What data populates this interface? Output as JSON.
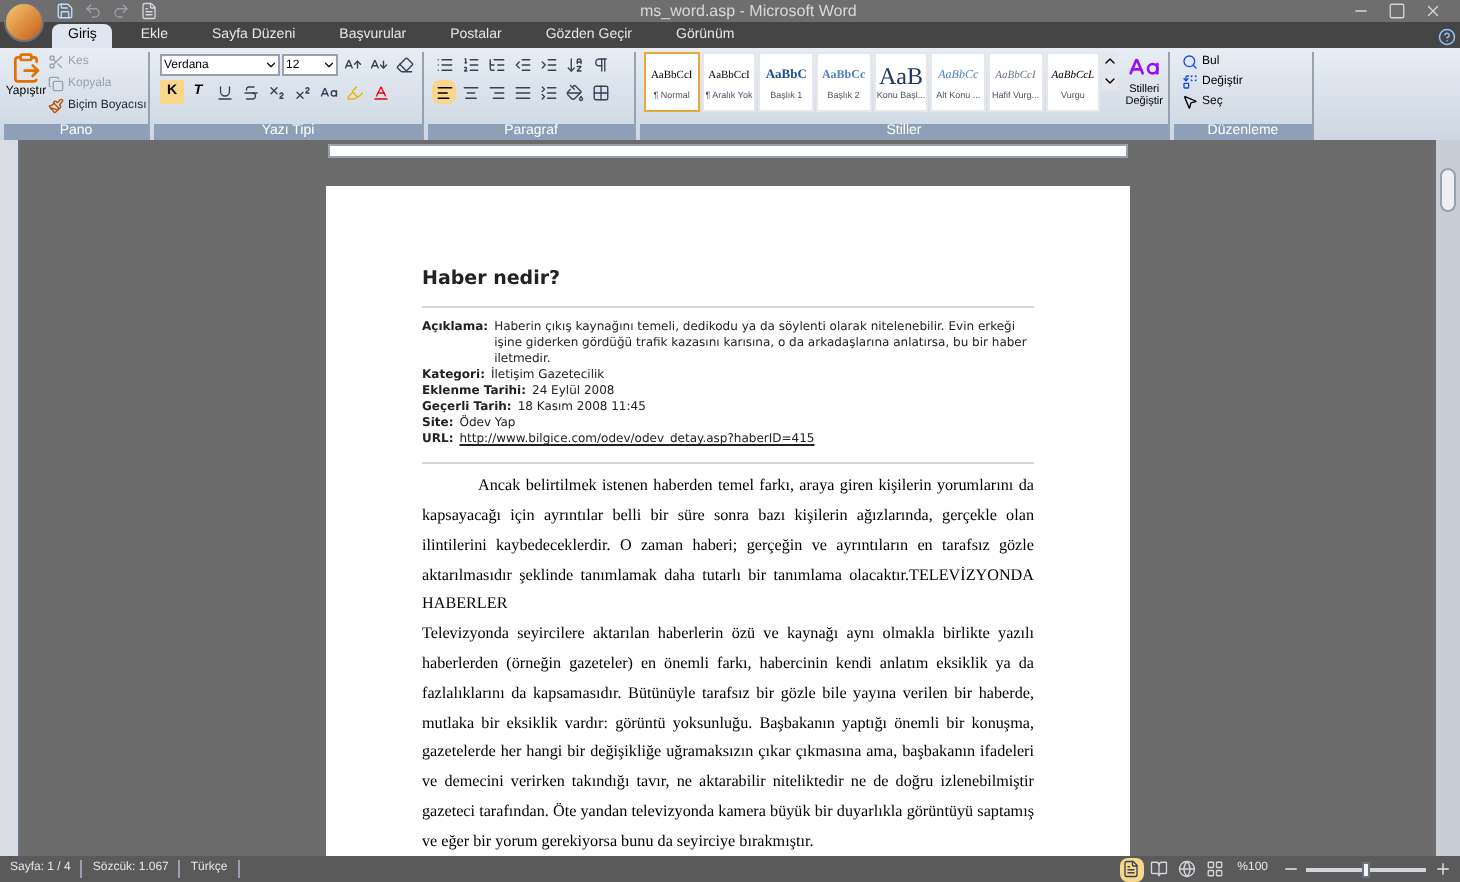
{
  "window": {
    "title": "ms_word.asp - Microsoft Word"
  },
  "tabs": [
    {
      "label": "Giriş",
      "selected": true
    },
    {
      "label": "Ekle",
      "selected": false
    },
    {
      "label": "Sayfa Düzeni",
      "selected": false
    },
    {
      "label": "Başvurular",
      "selected": false
    },
    {
      "label": "Postalar",
      "selected": false
    },
    {
      "label": "Gözden Geçir",
      "selected": false
    },
    {
      "label": "Görünüm",
      "selected": false
    }
  ],
  "clipboard": {
    "group": "Pano",
    "paste": "Yapıştır",
    "items": [
      {
        "label": "Kes",
        "disabled": true
      },
      {
        "label": "Kopyala",
        "disabled": true
      },
      {
        "label": "Biçim Boyacısı",
        "disabled": false
      }
    ]
  },
  "font": {
    "group": "Yazı Tipi",
    "name": "Verdana",
    "size": "12",
    "bold": "K",
    "italic": "T"
  },
  "paragraph": {
    "group": "Paragraf"
  },
  "styles": {
    "group": "Stiller",
    "items": [
      {
        "preview": "AaBbCcI",
        "name": "¶ Normal",
        "selected": true,
        "kind": "normal"
      },
      {
        "preview": "AaBbCcI",
        "name": "¶ Aralık Yok",
        "selected": false,
        "kind": "normal"
      },
      {
        "preview": "AaBbC",
        "name": "Başlık 1",
        "selected": false,
        "kind": "heading"
      },
      {
        "preview": "AaBbCc",
        "name": "Başlık 2",
        "selected": false,
        "kind": "heading2"
      },
      {
        "preview": "AaB",
        "name": "Konu Başl...",
        "selected": false,
        "kind": "title"
      },
      {
        "preview": "AaBbCc",
        "name": "Alt Konu ...",
        "selected": false,
        "kind": "subtitle"
      },
      {
        "preview": "AaBbCcI",
        "name": "Hafif Vurg...",
        "selected": false,
        "kind": "subtle"
      },
      {
        "preview": "AaBbCcL",
        "name": "Vurgu",
        "selected": false,
        "kind": "emphasis"
      }
    ],
    "change": "Stilleri Değiştir"
  },
  "editing": {
    "group": "Düzenleme",
    "items": [
      "Bul",
      "Değiştir",
      "Seç"
    ]
  },
  "document": {
    "heading": "Haber nedir?",
    "fields": [
      {
        "label": "Açıklama:",
        "value": "Haberin çıkış kaynağını temeli, dedikodu ya da söylenti olarak nitelenebilir. Evin erkeği işine giderken gördüğü trafik kazasını karısına, o da arkadaşlarına anlatırsa, bu bir haber iletmedir."
      },
      {
        "label": "Kategori:",
        "value": "İletişim Gazetecilik"
      },
      {
        "label": "Eklenme Tarihi:",
        "value": "24 Eylül 2008"
      },
      {
        "label": "Geçerli Tarih:",
        "value": "18 Kasım 2008 11:45"
      },
      {
        "label": "Site:",
        "value": "Ödev Yap"
      }
    ],
    "url": {
      "label": "URL:",
      "link": "http://www.bilgice.com/odev/odev_detay.asp?haberID=415"
    },
    "paragraphs": [
      {
        "text": "Ancak belirtilmek istenen haberden temel farkı, araya giren kişilerin yorumlarını da kapsayacağı için ayrıntılar belli bir süre sonra bazı kişilerin ağızlarında, gerçekle olan ilintilerini kaybedeceklerdir. O zaman haberi; gerçeğin ve ayrıntıların en tarafsız gözle aktarılmasıdır şeklinde tanımlamak daha tutarlı bir tanımlama olacaktır.TELEVİZYONDA HABERLER",
        "indent": true
      },
      {
        "text": "Televizyonda seyircilere aktarılan haberlerin özü ve kaynağı aynı olmakla birlikte yazılı haberlerden (örneğin gazeteler) en önemli farkı, habercinin kendi anlatım eksiklik ya da fazlalıklarını da kapsamasıdır. Bütünüyle tarafsız bir gözle bile yayına verilen bir haberde, mutlaka bir eksiklik vardır: görüntü yoksunluğu. Başbakanın yaptığı önemli bir konuşma, gazetelerde her hangi bir değişikliğe uğramaksızın çıkar çıkmasına ama, başbakanın ifadeleri ve demecini verirken takındığı tavır, ne aktarabilir niteliktedir ne de doğru izlenebilmiştir gazeteci tarafından. Öte yandan televizyonda kamera büyük bir duyarlıkla görüntüyü saptamış ve eğer bir yorum gerekiyorsa bunu da seyirciye bırakmıştır.",
        "indent": false
      }
    ]
  },
  "status_bar": {
    "items": [
      "Sayfa: 1 / 4",
      "Sözcük: 1.067",
      "Türkçe"
    ],
    "zoom": "%100",
    "zoom_slider": {
      "level": 0.5
    }
  }
}
